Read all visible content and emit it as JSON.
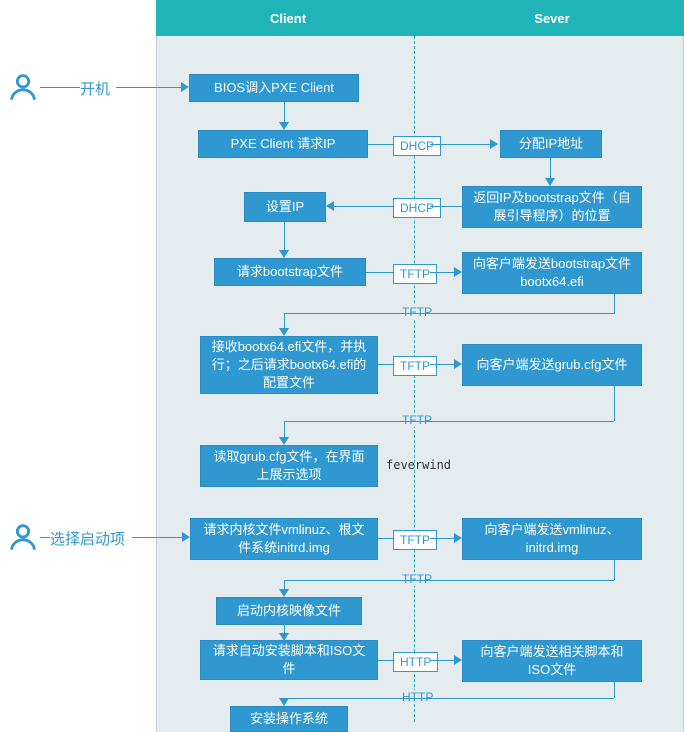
{
  "chart_data": {
    "type": "flowchart",
    "title": "PXE Boot Sequence",
    "columns": [
      "Client",
      "Sever"
    ],
    "external_actors": [
      {
        "icon": "user",
        "label": "开机",
        "connects_to": "bios_pxe"
      },
      {
        "icon": "user",
        "label": "选择启动项",
        "connects_to": "request_kernel"
      }
    ],
    "nodes": [
      {
        "id": "bios_pxe",
        "column": "Client",
        "text": "BIOS调入PXE Client"
      },
      {
        "id": "pxe_request_ip",
        "column": "Client",
        "text": "PXE Client 请求IP"
      },
      {
        "id": "alloc_ip",
        "column": "Sever",
        "text": "分配IP地址"
      },
      {
        "id": "return_ip_bootstrap",
        "column": "Sever",
        "text": "返回IP及bootstrap文件（自展引导程序）的位置"
      },
      {
        "id": "set_ip",
        "column": "Client",
        "text": "设置IP"
      },
      {
        "id": "request_bootstrap",
        "column": "Client",
        "text": "请求bootstrap文件"
      },
      {
        "id": "send_bootstrap",
        "column": "Sever",
        "text": "向客户端发送bootstrap文件bootx64.efi"
      },
      {
        "id": "receive_bootx64",
        "column": "Client",
        "text": "接收bootx64.efi文件，并执行；之后请求bootx64.efi的配置文件"
      },
      {
        "id": "send_grubcfg",
        "column": "Sever",
        "text": "向客户端发送grub.cfg文件"
      },
      {
        "id": "read_grubcfg",
        "column": "Client",
        "text": "读取grub.cfg文件，在界面上展示选项"
      },
      {
        "id": "request_kernel",
        "column": "Client",
        "text": "请求内核文件vmlinuz、根文件系统initrd.img"
      },
      {
        "id": "send_kernel",
        "column": "Sever",
        "text": "向客户端发送vmlinuz、initrd.img"
      },
      {
        "id": "boot_kernel_image",
        "column": "Client",
        "text": "启动内核映像文件"
      },
      {
        "id": "request_script_iso",
        "column": "Client",
        "text": "请求自动安装脚本和ISO文件"
      },
      {
        "id": "send_script_iso",
        "column": "Sever",
        "text": "向客户端发送相关脚本和ISO文件"
      },
      {
        "id": "install_os",
        "column": "Client",
        "text": "安装操作系统"
      }
    ],
    "edges": [
      {
        "from": "bios_pxe",
        "to": "pxe_request_ip",
        "label": ""
      },
      {
        "from": "pxe_request_ip",
        "to": "alloc_ip",
        "label": "DHCP"
      },
      {
        "from": "alloc_ip",
        "to": "return_ip_bootstrap",
        "label": ""
      },
      {
        "from": "return_ip_bootstrap",
        "to": "set_ip",
        "label": "DHCP"
      },
      {
        "from": "set_ip",
        "to": "request_bootstrap",
        "label": ""
      },
      {
        "from": "request_bootstrap",
        "to": "send_bootstrap",
        "label": "TFTP"
      },
      {
        "from": "send_bootstrap",
        "to": "receive_bootx64",
        "label": "TFTP"
      },
      {
        "from": "receive_bootx64",
        "to": "send_grubcfg",
        "label": "TFTP"
      },
      {
        "from": "send_grubcfg",
        "to": "read_grubcfg",
        "label": "TFTP"
      },
      {
        "from": "request_kernel",
        "to": "send_kernel",
        "label": "TFTP"
      },
      {
        "from": "send_kernel",
        "to": "boot_kernel_image",
        "label": "TFTP"
      },
      {
        "from": "boot_kernel_image",
        "to": "request_script_iso",
        "label": ""
      },
      {
        "from": "request_script_iso",
        "to": "send_script_iso",
        "label": "HTTP"
      },
      {
        "from": "send_script_iso",
        "to": "install_os",
        "label": "HTTP"
      }
    ],
    "watermark": "feverwind"
  },
  "header": {
    "client": "Client",
    "server": "Sever"
  },
  "actors": {
    "poweron": "开机",
    "select_boot": "选择启动项"
  },
  "proto": {
    "dhcp": "DHCP",
    "tftp": "TFTP",
    "http": "HTTP"
  },
  "watermark": "feverwind",
  "boxes": {
    "bios_pxe": "BIOS调入PXE Client",
    "pxe_request_ip": "PXE Client 请求IP",
    "alloc_ip": "分配IP地址",
    "return_ip_bootstrap": "返回IP及bootstrap文件（自展引导程序）的位置",
    "set_ip": "设置IP",
    "request_bootstrap": "请求bootstrap文件",
    "send_bootstrap": "向客户端发送bootstrap文件bootx64.efi",
    "receive_bootx64": "接收bootx64.efi文件，并执行；之后请求bootx64.efi的配置文件",
    "send_grubcfg": "向客户端发送grub.cfg文件",
    "read_grubcfg": "读取grub.cfg文件，在界面上展示选项",
    "request_kernel": "请求内核文件vmlinuz、根文件系统initrd.img",
    "send_kernel": "向客户端发送vmlinuz、initrd.img",
    "boot_kernel_image": "启动内核映像文件",
    "request_script_iso": "请求自动安装脚本和ISO文件",
    "send_script_iso": "向客户端发送相关脚本和ISO文件",
    "install_os": "安装操作系统"
  }
}
